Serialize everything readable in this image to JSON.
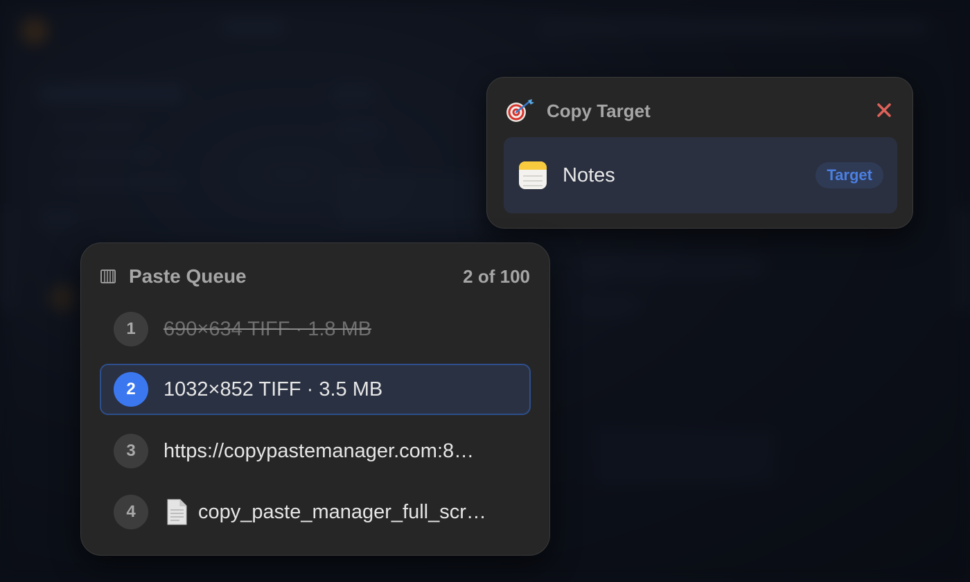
{
  "copy_target": {
    "title": "Copy Target",
    "target_icon": "dart-target-icon",
    "close_icon": "close-icon",
    "close_color": "#e0625a",
    "app": {
      "name": "Notes",
      "icon": "notes-app-icon",
      "badge": "Target"
    }
  },
  "paste_queue": {
    "title": "Paste Queue",
    "icon": "queue-icon",
    "count": "2 of 100",
    "accent": "#3b78f0",
    "items": [
      {
        "number": "1",
        "text": "690×634 TIFF · 1.8 MB",
        "state": "pasted"
      },
      {
        "number": "2",
        "text": "1032×852 TIFF · 3.5 MB",
        "state": "current"
      },
      {
        "number": "3",
        "text": "https://copypastemanager.com:8…",
        "state": "pending"
      },
      {
        "number": "4",
        "text": "copy_paste_manager_full_scr…",
        "state": "pending",
        "icon": "document-icon"
      }
    ]
  }
}
